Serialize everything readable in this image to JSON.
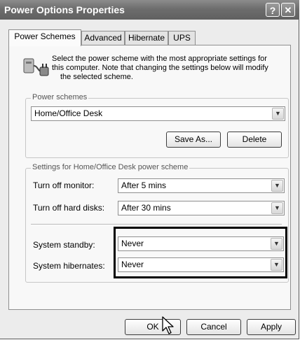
{
  "window": {
    "title": "Power Options Properties",
    "help_button": "?",
    "close_button": "✕"
  },
  "tabs": [
    {
      "label": "Power Schemes"
    },
    {
      "label": "Advanced"
    },
    {
      "label": "Hibernate"
    },
    {
      "label": "UPS"
    }
  ],
  "intro": {
    "line1": "Select the power scheme with the most appropriate settings for",
    "line2": "this computer. Note that changing the settings below will modify",
    "line3": "the selected scheme.",
    "icon": "power-options-icon"
  },
  "power_schemes": {
    "legend": "Power schemes",
    "selected": "Home/Office Desk",
    "save_as_label": "Save As...",
    "delete_label": "Delete"
  },
  "settings": {
    "legend": "Settings for Home/Office Desk power scheme",
    "turn_off_monitor_label": "Turn off monitor:",
    "turn_off_monitor_value": "After 5 mins",
    "turn_off_disks_label": "Turn off hard disks:",
    "turn_off_disks_value": "After 30 mins",
    "standby_label": "System standby:",
    "standby_value": "Never",
    "hibernates_label": "System hibernates:",
    "hibernates_value": "Never"
  },
  "footer": {
    "ok_label": "OK",
    "cancel_label": "Cancel",
    "apply_label": "Apply"
  },
  "colors": {
    "titlebar": "#6d6d6d",
    "dialog_bg": "#ececec",
    "highlight_border": "#000000"
  }
}
